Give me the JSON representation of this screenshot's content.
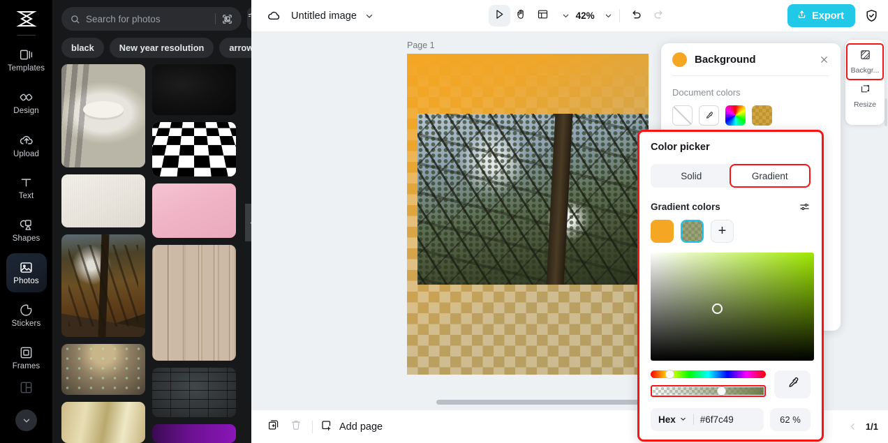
{
  "app": {
    "logo": "capcut-logo"
  },
  "sidebar": {
    "items": [
      {
        "label": "Templates",
        "icon": "templates-icon",
        "active": false
      },
      {
        "label": "Design",
        "icon": "design-icon",
        "active": false
      },
      {
        "label": "Upload",
        "icon": "upload-icon",
        "active": false
      },
      {
        "label": "Text",
        "icon": "text-icon",
        "active": false
      },
      {
        "label": "Shapes",
        "icon": "shapes-icon",
        "active": false
      },
      {
        "label": "Photos",
        "icon": "photos-icon",
        "active": true
      },
      {
        "label": "Stickers",
        "icon": "sticker-icon",
        "active": false
      },
      {
        "label": "Frames",
        "icon": "frames-icon",
        "active": false
      }
    ],
    "more_label": "chevron-down"
  },
  "photos_panel": {
    "search": {
      "placeholder": "Search for photos",
      "value": ""
    },
    "image_search_icon": "image-search-icon",
    "filter_icon": "filter-icon",
    "chips": [
      "black",
      "New year resolution",
      "arrow"
    ],
    "thumbnails": [
      {
        "name": "cafe-table-photo"
      },
      {
        "name": "dark-texture-photo"
      },
      {
        "name": "checkerboard-photo"
      },
      {
        "name": "paper-texture-photo"
      },
      {
        "name": "pink-paper-photo"
      },
      {
        "name": "forest-sunlight-photo"
      },
      {
        "name": "wood-planks-photo"
      },
      {
        "name": "drone-landscape-photo"
      },
      {
        "name": "dark-brick-photo"
      },
      {
        "name": "gold-gradient-photo"
      },
      {
        "name": "purple-gradient-photo"
      }
    ],
    "collapse_icon": "chevron-left"
  },
  "topbar": {
    "cloud_icon": "cloud-sync-icon",
    "doc_title": "Untitled image",
    "title_caret": "chevron-down-icon",
    "tools": [
      {
        "name": "select-tool",
        "icon": "cursor-icon",
        "selected": true
      },
      {
        "name": "hand-tool",
        "icon": "hand-icon",
        "selected": false
      },
      {
        "name": "layout-tool",
        "icon": "layout-icon",
        "selected": false
      }
    ],
    "zoom": "42%",
    "undo_icon": "undo-icon",
    "redo_icon": "redo-icon",
    "export_label": "Export",
    "export_color": "#20c9e8",
    "shield_icon": "shield-check-icon"
  },
  "canvas": {
    "page_label": "Page 1",
    "background_gradient_from": "#f5a623",
    "background_gradient_to": "#6f7c49",
    "photo_object": "forest-canopy-image"
  },
  "bottombar": {
    "duplicate_icon": "duplicate-page-icon",
    "delete_icon": "trash-icon",
    "add_page_label": "Add page",
    "add_page_icon": "add-page-icon",
    "prev_icon": "chevron-left-icon",
    "page_indicator": "1/1"
  },
  "right_rail": {
    "items": [
      {
        "label": "Backgr...",
        "icon": "background-icon",
        "highlighted": true
      },
      {
        "label": "Resize",
        "icon": "resize-icon",
        "highlighted": false
      }
    ]
  },
  "background_panel": {
    "title": "Background",
    "swatch_color": "#f5a623",
    "close_icon": "close-icon",
    "document_colors_label": "Document colors",
    "swatches": [
      {
        "name": "no-color-swatch",
        "kind": "none"
      },
      {
        "name": "eyedropper-swatch",
        "kind": "picker"
      },
      {
        "name": "color-wheel-swatch",
        "kind": "wheel"
      },
      {
        "name": "gold-checker-swatch",
        "kind": "goldchk",
        "color": "#d3a63d"
      }
    ]
  },
  "color_picker": {
    "title": "Color picker",
    "tabs": [
      {
        "label": "Solid",
        "active": false,
        "highlighted": false
      },
      {
        "label": "Gradient",
        "active": true,
        "highlighted": true
      }
    ],
    "gradient_colors_label": "Gradient colors",
    "settings_icon": "sliders-icon",
    "stops": [
      {
        "name": "gradient-stop-1",
        "color": "#f5a623",
        "selected": false
      },
      {
        "name": "gradient-stop-2",
        "color": "#9aa477",
        "selected": true
      },
      {
        "name": "add-gradient-stop",
        "symbol": "+"
      }
    ],
    "sv_color": "#9ee800",
    "hue_position_pct": 14,
    "alpha_position_pct": 62,
    "eyedropper_icon": "eyedropper-icon",
    "hex_mode": "Hex",
    "hex_mode_caret": "chevron-down-icon",
    "hex_value": "#6f7c49",
    "opacity_value": "62 %"
  }
}
